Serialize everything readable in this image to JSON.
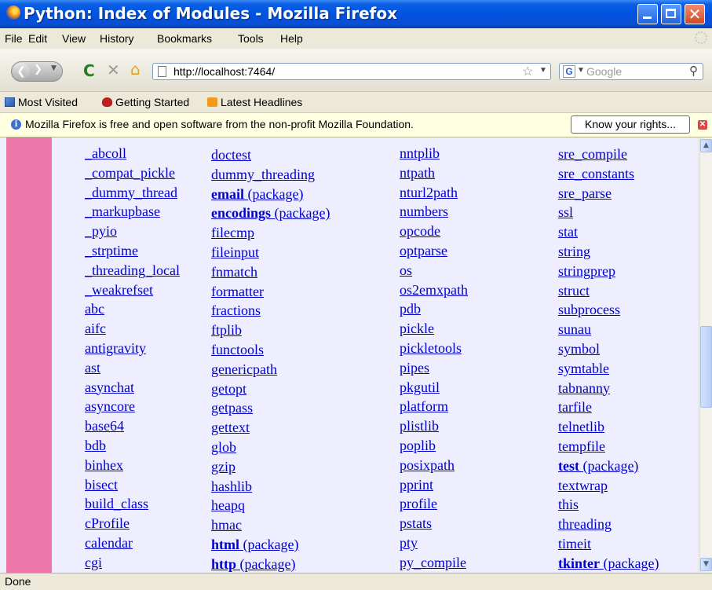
{
  "window": {
    "title": "Python: Index of Modules - Mozilla Firefox",
    "close_glyph": "✕"
  },
  "menu": [
    "File",
    "Edit",
    "View",
    "History",
    "Bookmarks",
    "Tools",
    "Help"
  ],
  "nav": {
    "url": "http://localhost:7464/",
    "search_engine": "G",
    "search_placeholder": "Google"
  },
  "bookmarks": [
    "Most Visited",
    "Getting Started",
    "Latest Headlines"
  ],
  "notification": {
    "message": "Mozilla Firefox is free and open software from the non-profit Mozilla Foundation.",
    "button": "Know your rights..."
  },
  "modules": {
    "col1": [
      "_abcoll",
      "_compat_pickle",
      "_dummy_thread",
      "_markupbase",
      "_pyio",
      "_strptime",
      "_threading_local",
      "_weakrefset",
      "abc",
      "aifc",
      "antigravity",
      "ast",
      "asynchat",
      "asyncore",
      "base64",
      "bdb",
      "binhex",
      "bisect",
      "build_class",
      "cProfile",
      "calendar",
      "cgi"
    ],
    "col2": [
      {
        "name": "doctest"
      },
      {
        "name": "dummy_threading"
      },
      {
        "name": "email",
        "pkg": " (package)"
      },
      {
        "name": "encodings",
        "pkg": " (package)"
      },
      {
        "name": "filecmp"
      },
      {
        "name": "fileinput"
      },
      {
        "name": "fnmatch"
      },
      {
        "name": "formatter"
      },
      {
        "name": "fractions"
      },
      {
        "name": "ftplib"
      },
      {
        "name": "functools"
      },
      {
        "name": "genericpath"
      },
      {
        "name": "getopt"
      },
      {
        "name": "getpass"
      },
      {
        "name": "gettext"
      },
      {
        "name": "glob"
      },
      {
        "name": "gzip"
      },
      {
        "name": "hashlib"
      },
      {
        "name": "heapq"
      },
      {
        "name": "hmac"
      },
      {
        "name": "html",
        "pkg": " (package)"
      },
      {
        "name": "http",
        "pkg": " (package)"
      }
    ],
    "col3": [
      "nntplib",
      "ntpath",
      "nturl2path",
      "numbers",
      "opcode",
      "optparse",
      "os",
      "os2emxpath",
      "pdb",
      "pickle",
      "pickletools",
      "pipes",
      "pkgutil",
      "platform",
      "plistlib",
      "poplib",
      "posixpath",
      "pprint",
      "profile",
      "pstats",
      "pty",
      "py_compile"
    ],
    "col4": [
      {
        "name": "sre_compile"
      },
      {
        "name": "sre_constants"
      },
      {
        "name": "sre_parse"
      },
      {
        "name": "ssl"
      },
      {
        "name": "stat"
      },
      {
        "name": "string"
      },
      {
        "name": "stringprep"
      },
      {
        "name": "struct"
      },
      {
        "name": "subprocess"
      },
      {
        "name": "sunau"
      },
      {
        "name": "symbol"
      },
      {
        "name": "symtable"
      },
      {
        "name": "tabnanny"
      },
      {
        "name": "tarfile"
      },
      {
        "name": "telnetlib"
      },
      {
        "name": "tempfile"
      },
      {
        "name": "test",
        "pkg": " (package)"
      },
      {
        "name": "textwrap"
      },
      {
        "name": "this"
      },
      {
        "name": "threading"
      },
      {
        "name": "timeit"
      },
      {
        "name": "tkinter",
        "pkg": " (package)"
      }
    ]
  },
  "status": "Done"
}
